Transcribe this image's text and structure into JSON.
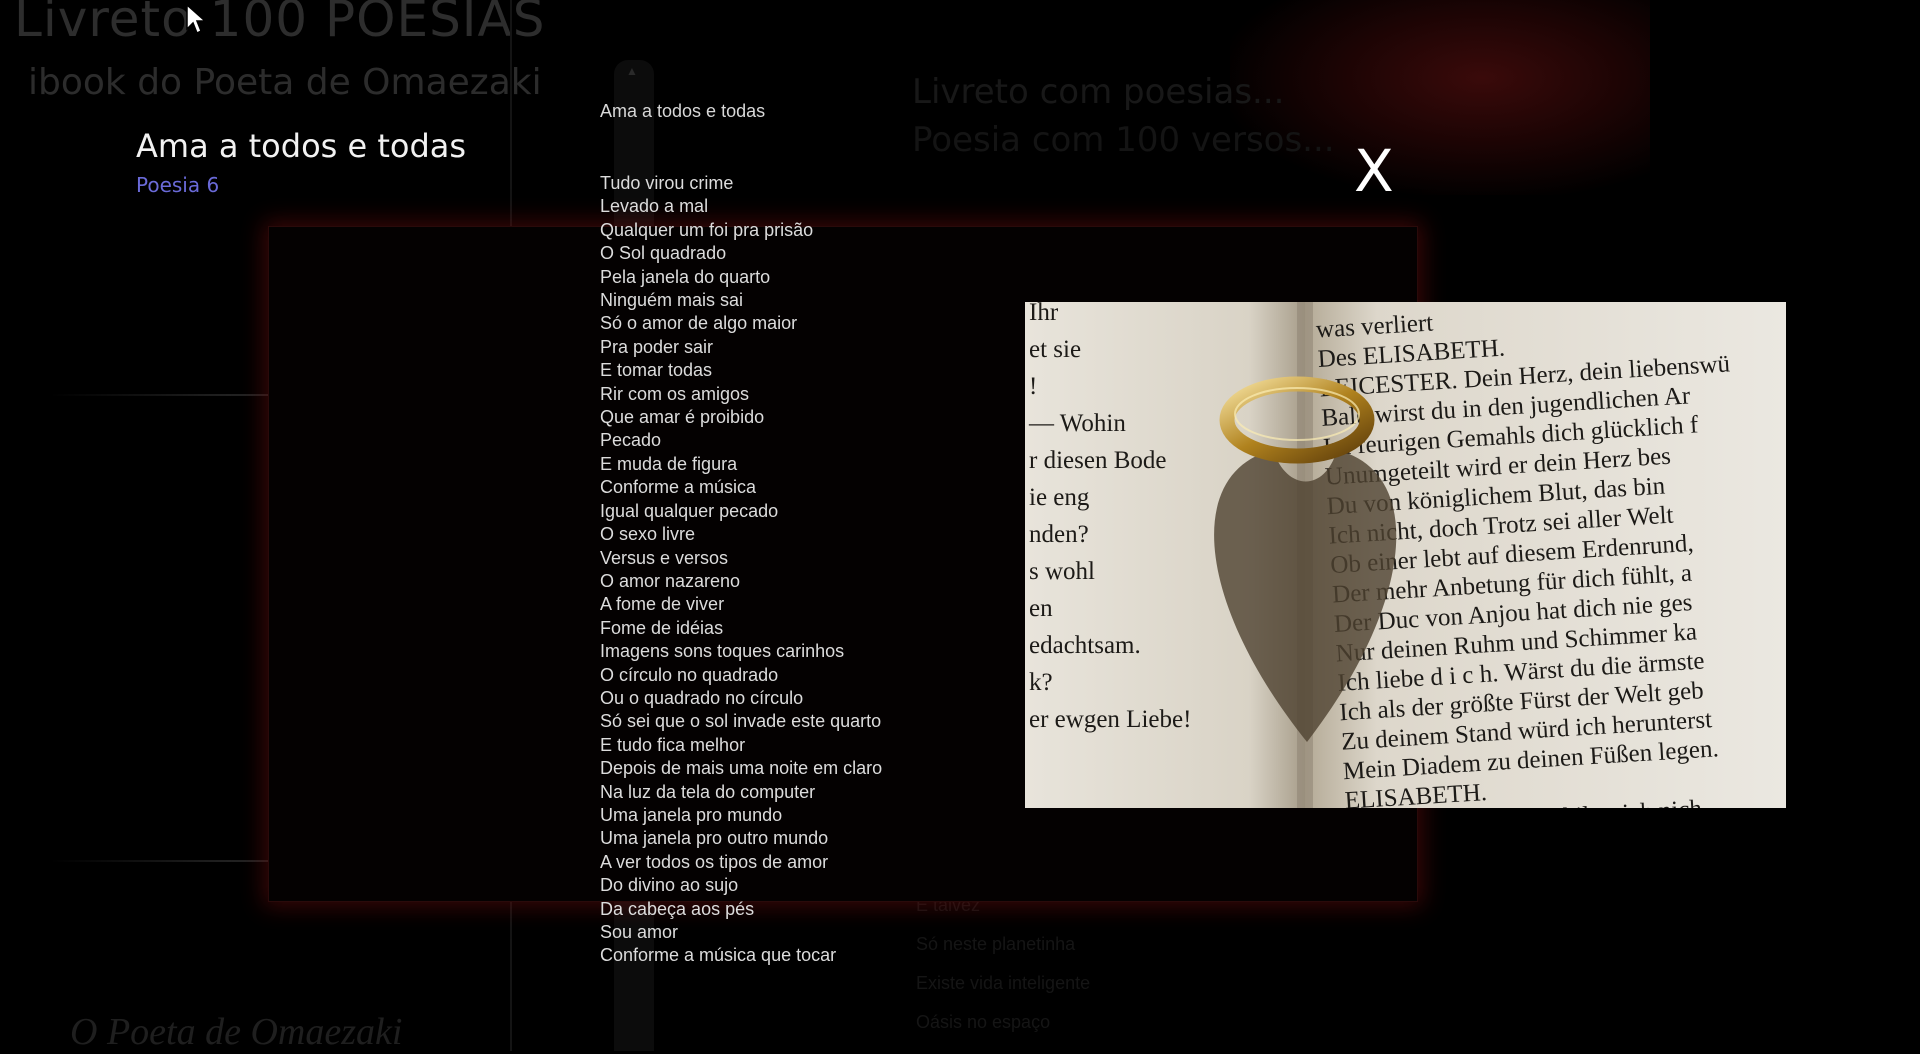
{
  "app": {
    "title": "Livreto 100 POESIAS",
    "subtitle": "ibook do Poeta de Omaezaki",
    "signature": "O Poeta de Omaezaki"
  },
  "sidebar": {
    "poem_title": "Ama a todos e todas",
    "poem_number": "Poesia 6"
  },
  "background": {
    "heading_1": "Livreto com poesias...",
    "heading_2": "Poesia com 100 versos...",
    "snippets": [
      "E talvez",
      "Só neste planetinha",
      "Existe vida inteligente",
      "Oásis no espaço"
    ]
  },
  "overlay": {
    "close_label": "X",
    "poem_heading": "Ama a todos e todas",
    "verses": [
      "Tudo virou crime",
      "Levado a mal",
      "Qualquer um foi pra prisão",
      "O Sol quadrado",
      "Pela janela do quarto",
      "Ninguém mais sai",
      "Só o amor de algo maior",
      "Pra poder sair",
      "E tomar todas",
      "Rir com os amigos",
      "Que amar é proibido",
      "Pecado",
      "E muda de figura",
      "Conforme a música",
      "Igual qualquer pecado",
      "O sexo livre",
      "Versus e versos",
      "O amor nazareno",
      "A fome de viver",
      "Fome de idéias",
      "Imagens sons toques carinhos",
      "O círculo no quadrado",
      "Ou o quadrado no círculo",
      "Só sei que o sol invade este quarto",
      "E tudo fica melhor",
      "Depois de mais uma noite em claro",
      "Na luz da tela do computer",
      "Uma janela pro mundo",
      "Uma janela pro outro mundo",
      "A ver todos os tipos de amor",
      "Do divino ao sujo",
      "Da cabeça aos pés",
      "Sou amor",
      "Conforme a música que tocar"
    ],
    "photo": {
      "left_page_lines": [
        "Ihr",
        "et sie",
        "!",
        "— Wohin",
        "r diesen Bode",
        "ie eng",
        "nden?",
        "s wohl",
        "en",
        "edachtsam.",
        "k?",
        "er ewgen Liebe!"
      ],
      "right_page_lines": [
        "was verliert",
        "Des ELISABETH.",
        "LEICESTER. Dein Herz, dein liebenswü",
        "Bald wirst du in den jugendlichen Ar",
        "Im feurigen Gemahls dich glücklich f",
        "Unumgeteilt wird er dein Herz bes",
        "Du von königlichem Blut, das bin",
        "Ich nicht, doch Trotz sei aller Welt",
        "Ob einer lebt auf diesem Erdenrund,",
        "Der mehr Anbetung für dich fühlt, a",
        "Der Duc von Anjou hat dich nie ges",
        "Nur deinen Ruhm und Schimmer ka",
        "Ich liebe d i c h. Wärst du die ärmste",
        "Ich als der größte Fürst der Welt geb",
        "Zu deinem Stand würd ich herunterst",
        "Mein Diadem zu deinen Füßen legen.",
        "ELISABETH.",
        "klag mich, Dudley, schilt mich nich"
      ]
    }
  },
  "colors": {
    "accent_blue": "#6a6ad8",
    "frame_glow": "#6e0c0c",
    "text": "#dcdcdc"
  },
  "icons": [
    "mouse-cursor-icon",
    "close-icon",
    "scroll-up-arrow-icon"
  ]
}
